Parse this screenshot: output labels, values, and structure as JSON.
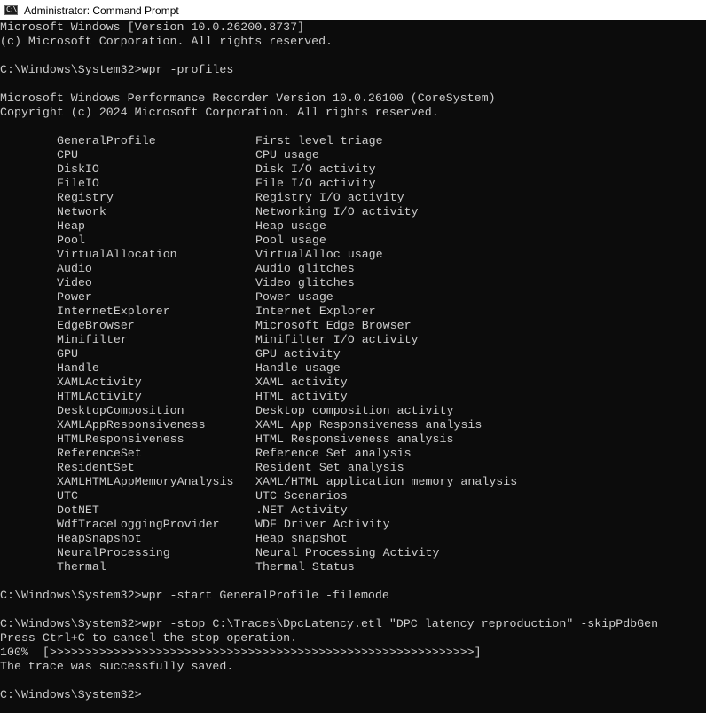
{
  "window": {
    "title": "Administrator: Command Prompt",
    "icon": "command-prompt-icon",
    "icon_glyph": "C:\\"
  },
  "console": {
    "banner": [
      "Microsoft Windows [Version 10.0.26200.8737]",
      "(c) Microsoft Corporation. All rights reserved."
    ],
    "command1": "C:\\Windows\\System32>wpr -profiles",
    "wpr_banner": [
      "Microsoft Windows Performance Recorder Version 10.0.26100 (CoreSystem)",
      "Copyright (c) 2024 Microsoft Corporation. All rights reserved."
    ],
    "profiles": [
      {
        "name": "GeneralProfile",
        "description": "First level triage"
      },
      {
        "name": "CPU",
        "description": "CPU usage"
      },
      {
        "name": "DiskIO",
        "description": "Disk I/O activity"
      },
      {
        "name": "FileIO",
        "description": "File I/O activity"
      },
      {
        "name": "Registry",
        "description": "Registry I/O activity"
      },
      {
        "name": "Network",
        "description": "Networking I/O activity"
      },
      {
        "name": "Heap",
        "description": "Heap usage"
      },
      {
        "name": "Pool",
        "description": "Pool usage"
      },
      {
        "name": "VirtualAllocation",
        "description": "VirtualAlloc usage"
      },
      {
        "name": "Audio",
        "description": "Audio glitches"
      },
      {
        "name": "Video",
        "description": "Video glitches"
      },
      {
        "name": "Power",
        "description": "Power usage"
      },
      {
        "name": "InternetExplorer",
        "description": "Internet Explorer"
      },
      {
        "name": "EdgeBrowser",
        "description": "Microsoft Edge Browser"
      },
      {
        "name": "Minifilter",
        "description": "Minifilter I/O activity"
      },
      {
        "name": "GPU",
        "description": "GPU activity"
      },
      {
        "name": "Handle",
        "description": "Handle usage"
      },
      {
        "name": "XAMLActivity",
        "description": "XAML activity"
      },
      {
        "name": "HTMLActivity",
        "description": "HTML activity"
      },
      {
        "name": "DesktopComposition",
        "description": "Desktop composition activity"
      },
      {
        "name": "XAMLAppResponsiveness",
        "description": "XAML App Responsiveness analysis"
      },
      {
        "name": "HTMLResponsiveness",
        "description": "HTML Responsiveness analysis"
      },
      {
        "name": "ReferenceSet",
        "description": "Reference Set analysis"
      },
      {
        "name": "ResidentSet",
        "description": "Resident Set analysis"
      },
      {
        "name": "XAMLHTMLAppMemoryAnalysis",
        "description": "XAML/HTML application memory analysis"
      },
      {
        "name": "UTC",
        "description": "UTC Scenarios"
      },
      {
        "name": "DotNET",
        "description": ".NET Activity"
      },
      {
        "name": "WdfTraceLoggingProvider",
        "description": "WDF Driver Activity"
      },
      {
        "name": "HeapSnapshot",
        "description": "Heap snapshot"
      },
      {
        "name": "NeuralProcessing",
        "description": "Neural Processing Activity"
      },
      {
        "name": "Thermal",
        "description": "Thermal Status"
      }
    ],
    "command2": "C:\\Windows\\System32>wpr -start GeneralProfile -filemode",
    "command3": "C:\\Windows\\System32>wpr -stop C:\\Traces\\DpcLatency.etl \"DPC latency reproduction\" -skipPdbGen",
    "stop_hint": "Press Ctrl+C to cancel the stop operation.",
    "progress_line": "100%  [>>>>>>>>>>>>>>>>>>>>>>>>>>>>>>>>>>>>>>>>>>>>>>>>>>>>>>>>>>>>]",
    "progress_percent": 100,
    "saved_message": "The trace was successfully saved.",
    "prompt": "C:\\Windows\\System32>"
  }
}
